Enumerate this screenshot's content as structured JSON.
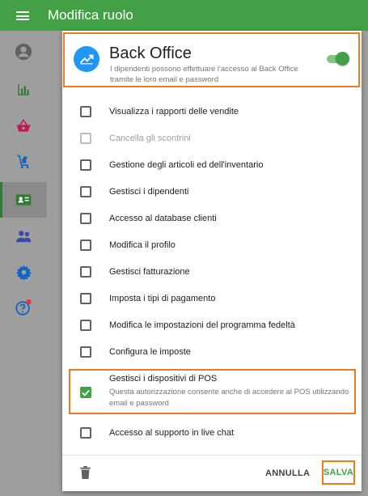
{
  "appbar": {
    "title": "Modifica ruolo"
  },
  "colors": {
    "accent": "#43a047",
    "highlight": "#ef7a23",
    "icon_blue": "#2196f3"
  },
  "back_office": {
    "title": "Back Office",
    "description": "I dipendenti possono effettuare l'accesso al Back Office tramite le loro email e password",
    "enabled": true
  },
  "permissions": [
    {
      "label": "Visualizza i rapporti delle vendite",
      "checked": false,
      "disabled": false
    },
    {
      "label": "Cancella gli scontrini",
      "checked": false,
      "disabled": true
    },
    {
      "label": "Gestione degli articoli ed dell'inventario",
      "checked": false,
      "disabled": false
    },
    {
      "label": "Gestisci i dipendenti",
      "checked": false,
      "disabled": false
    },
    {
      "label": "Accesso al database clienti",
      "checked": false,
      "disabled": false
    },
    {
      "label": "Modifica il profilo",
      "checked": false,
      "disabled": false
    },
    {
      "label": "Gestisci fatturazione",
      "checked": false,
      "disabled": false
    },
    {
      "label": "Imposta i tipi di pagamento",
      "checked": false,
      "disabled": false
    },
    {
      "label": "Modifica le impostazioni del programma fedeltà",
      "checked": false,
      "disabled": false
    },
    {
      "label": "Configura le imposte",
      "checked": false,
      "disabled": false
    }
  ],
  "pos_permission": {
    "label": "Gestisci i dispositivi di POS",
    "description": "Questa autorizzazione consente anche di accedere al POS utilizzando email e password",
    "checked": true
  },
  "support_permission": {
    "label": "Accesso al supporto in live chat",
    "checked": false
  },
  "footer": {
    "cancel_label": "ANNULLA",
    "save_label": "SALVA"
  },
  "sidebar": {
    "items": [
      {
        "icon": "account-icon"
      },
      {
        "icon": "bar-chart-icon"
      },
      {
        "icon": "basket-icon"
      },
      {
        "icon": "inventory-cart-icon"
      },
      {
        "icon": "employee-badge-icon",
        "active": true
      },
      {
        "icon": "customers-icon"
      },
      {
        "icon": "settings-gear-icon"
      },
      {
        "icon": "help-icon",
        "badge": true
      }
    ]
  }
}
